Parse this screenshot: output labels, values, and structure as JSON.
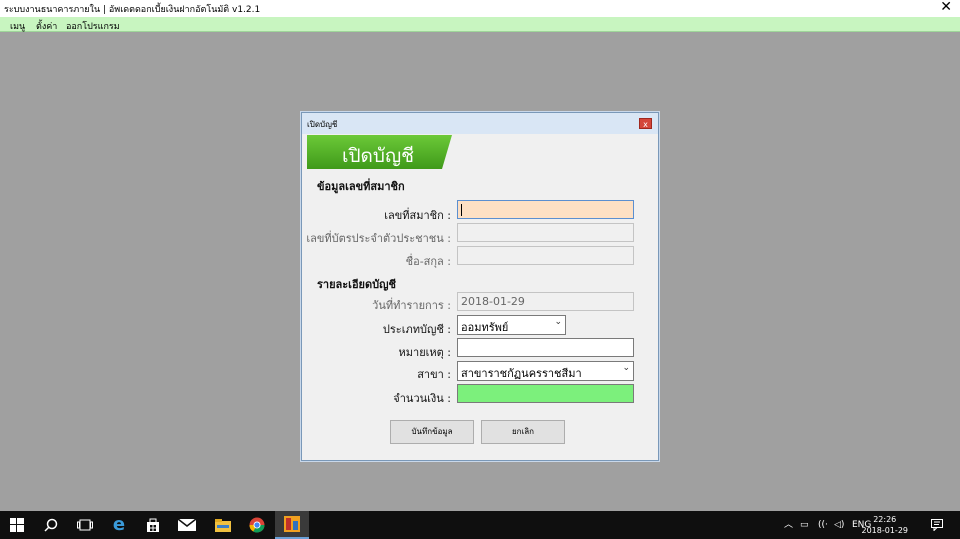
{
  "app": {
    "title": "ระบบงานธนาคารภายใน | อัพเดตดอกเบี้ยเงินฝากอัตโนมัติ   v1.2.1",
    "close_symbol": "✕"
  },
  "menu": {
    "items": [
      "เมนู",
      "ตั้งค่า",
      "ออกโปรแกรม"
    ]
  },
  "dialog": {
    "title": "เปิดบัญชี",
    "close_symbol": "x",
    "banner_text": "เปิดบัญชี",
    "banner_color": "#5db82b",
    "section_member": "ข้อมูลเลขที่สมาชิก",
    "member_no_label": "เลขที่สมาชิก :",
    "member_no_value": "",
    "id_card_label": "เลขที่บัตรประจำตัวประชาชน :",
    "id_card_value": "",
    "name_label": "ชื่อ-สกุล :",
    "name_value": "",
    "section_account": "รายละเอียดบัญชี",
    "txn_date_label": "วันที่ทำรายการ :",
    "txn_date_value": "2018-01-29",
    "acct_type_label": "ประเภทบัญชี :",
    "acct_type_value": "ออมทรัพย์",
    "note_label": "หมายเหตุ :",
    "note_value": "",
    "branch_label": "สาขา :",
    "branch_value": "สาขาราชกัฏนครราชสีมา",
    "amount_label": "จำนวนเงิน :",
    "amount_value": "",
    "save_button": "บันทึกข้อมูล",
    "cancel_button": "ยกเลิก"
  },
  "taskbar": {
    "tray_language": "ENG",
    "clock_time": "22:26",
    "clock_date": "2018-01-29"
  }
}
